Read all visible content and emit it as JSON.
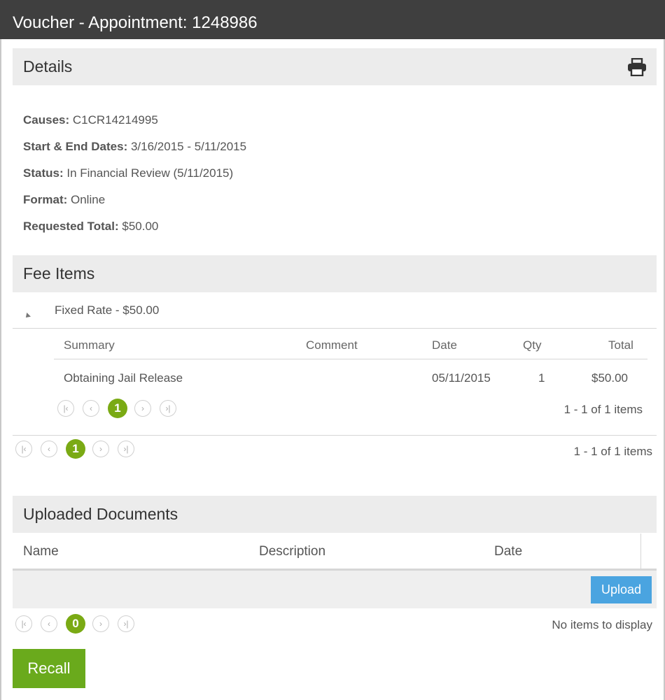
{
  "window": {
    "title": "Voucher - Appointment: 1248986"
  },
  "details": {
    "heading": "Details",
    "icon": "print-icon",
    "fields": [
      {
        "label": "Causes:",
        "value": " C1CR14214995"
      },
      {
        "label": "Start & End Dates:",
        "value": " 3/16/2015 - 5/11/2015"
      },
      {
        "label": "Status:",
        "value": " In Financial Review (5/11/2015)"
      },
      {
        "label": "Format:",
        "value": " Online"
      },
      {
        "label": "Requested Total:",
        "value": " $50.00"
      }
    ]
  },
  "fee_items": {
    "heading": "Fee Items",
    "group_label": "Fixed Rate - $50.00",
    "columns": {
      "summary": "Summary",
      "comment": "Comment",
      "date": "Date",
      "qty": "Qty",
      "total": "Total"
    },
    "rows": [
      {
        "summary": "Obtaining Jail Release",
        "comment": "",
        "date": "05/11/2015",
        "qty": "1",
        "total": "$50.00"
      }
    ],
    "inner_pager": {
      "page": "1",
      "info": "1 - 1 of 1 items"
    },
    "outer_pager": {
      "page": "1",
      "info": "1 - 1 of 1 items"
    }
  },
  "uploaded_documents": {
    "heading": "Uploaded Documents",
    "columns": {
      "name": "Name",
      "description": "Description",
      "date": "Date"
    },
    "upload_label": "Upload",
    "pager": {
      "page": "0",
      "info": "No items to display"
    }
  },
  "actions": {
    "recall_label": "Recall"
  },
  "pager_icons": {
    "first": "first-page-icon",
    "prev": "prev-page-icon",
    "next": "next-page-icon",
    "last": "last-page-icon"
  },
  "colors": {
    "titlebar": "#3f3f3f",
    "section": "#ececec",
    "accent_green": "#7aaa14",
    "upload_blue": "#4aa4e0"
  }
}
